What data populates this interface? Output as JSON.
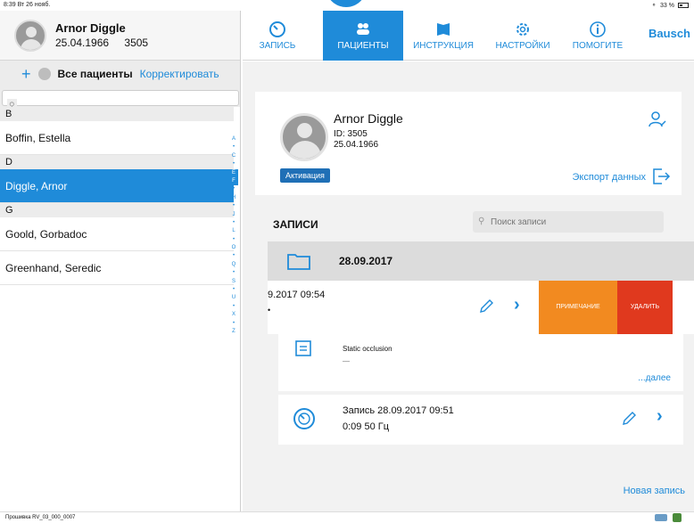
{
  "status": {
    "time": "8:39  Вт 26 нояб.",
    "battery": "33 %"
  },
  "colors": {
    "accent": "#1f8bd9",
    "selected_row": "#1f8bd9",
    "note_action": "#f28a20",
    "delete_action": "#e0391e"
  },
  "header": {
    "name": "Arnor Diggle",
    "dob": "25.04.1966",
    "id": "3505"
  },
  "left": {
    "title": "Все пациенты",
    "edit": "Корректировать",
    "search_placeholder": "",
    "sections": [
      {
        "letter": "B",
        "items": [
          "Boffin, Estella"
        ]
      },
      {
        "letter": "D",
        "items": [
          "Diggle, Arnor"
        ]
      },
      {
        "letter": "G",
        "items": [
          "Goold, Gorbadoc",
          "Greenhand, Seredic"
        ]
      }
    ],
    "index": [
      "A",
      "•",
      "C",
      "•",
      "E",
      "F",
      "•",
      "H",
      "•",
      "J",
      "•",
      "L",
      "•",
      "O",
      "•",
      "Q",
      "•",
      "S",
      "•",
      "U",
      "•",
      "X",
      "•",
      "Z"
    ]
  },
  "nav": {
    "tabs": [
      {
        "label": "ЗАПИСЬ",
        "icon": "gauge-icon"
      },
      {
        "label": "ПАЦИЕНТЫ",
        "icon": "patients-icon"
      },
      {
        "label": "ИНСТРУКЦИЯ",
        "icon": "book-icon"
      },
      {
        "label": "НАСТРОЙКИ",
        "icon": "gear-icon"
      },
      {
        "label": "ПОМОГИТЕ",
        "icon": "info-icon"
      }
    ],
    "brand": "Bausch"
  },
  "patient": {
    "name": "Arnor Diggle",
    "id": "ID: 3505",
    "dob": "25.04.1966",
    "activate": "Активация",
    "export": "Экспорт данных"
  },
  "records": {
    "header": "ЗАПИСИ",
    "search_placeholder": "Поиск записи",
    "date": "28.09.2017",
    "entry_title": "9.2017 09:54",
    "entry_dot": "•",
    "swipe_note": "ПРИМЕЧАНИЕ",
    "swipe_delete": "УДАЛИТЬ",
    "sub_title": "Static occlusion",
    "sub_detail": "—",
    "more": "...далее",
    "entry2_title": "Запись 28.09.2017 09:51",
    "entry2_sub": "0:09   50 Гц",
    "new_record": "Новая запись"
  },
  "footer": {
    "firmware": "Прошивка RV_03_000_0007"
  }
}
